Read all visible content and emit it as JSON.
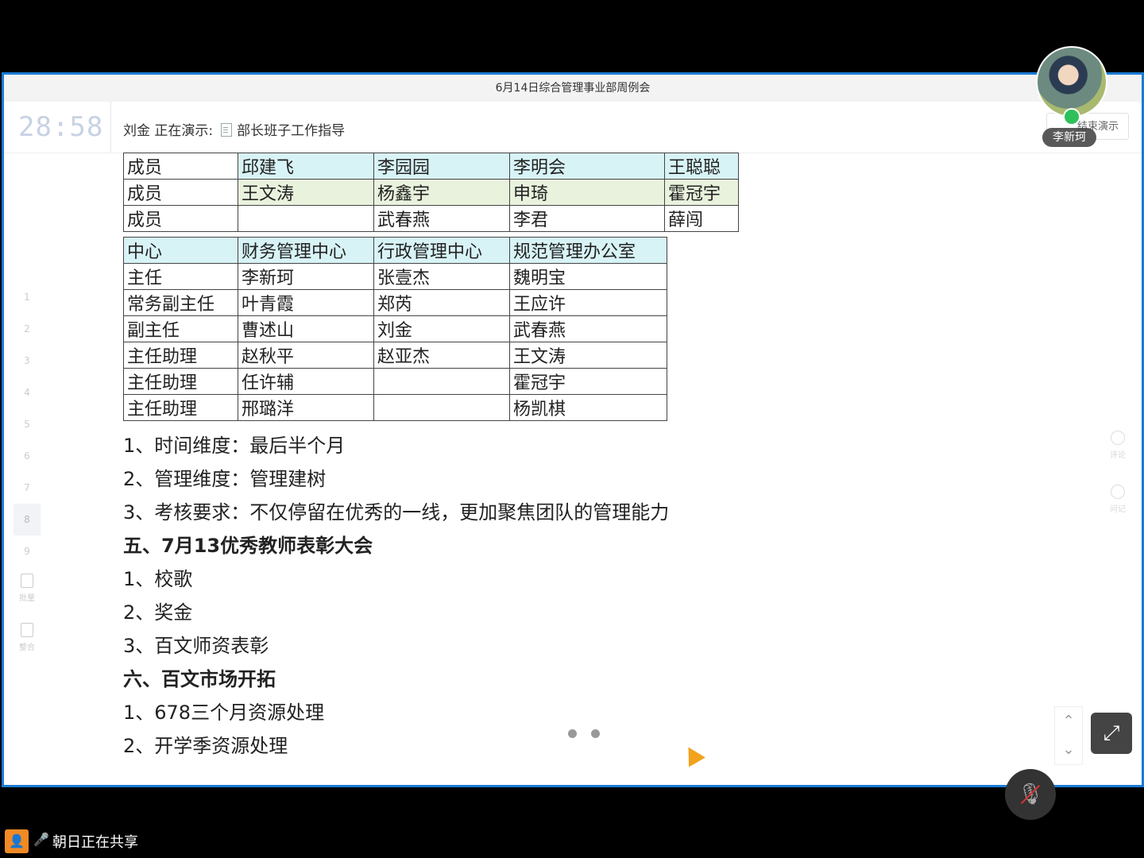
{
  "meeting": {
    "title": "6月14日综合管理事业部周例会"
  },
  "status": {
    "timer": "28:58",
    "presenter_label": "刘金 正在演示:",
    "doc_name": "部长班子工作指导",
    "end_button": "结束演示"
  },
  "sidebar": {
    "slides": [
      "1",
      "2",
      "3",
      "4",
      "5",
      "6",
      "7",
      "8",
      "9"
    ],
    "tools": [
      "批量",
      "整合"
    ]
  },
  "right_tools": [
    "评论",
    "问记"
  ],
  "table1": {
    "rows": [
      [
        "成员",
        "邱建飞",
        "李园园",
        "李明会",
        "王聪聪"
      ],
      [
        "成员",
        "王文涛",
        "杨鑫宇",
        "申琦",
        "霍冠宇"
      ],
      [
        "成员",
        "",
        "武春燕",
        "李君",
        "薛闯"
      ]
    ]
  },
  "table2": {
    "header": [
      "中心",
      "财务管理中心",
      "行政管理中心",
      "规范管理办公室"
    ],
    "rows": [
      [
        "主任",
        "李新珂",
        "张壹杰",
        "魏明宝"
      ],
      [
        "常务副主任",
        "叶青霞",
        "郑芮",
        "王应许"
      ],
      [
        "副主任",
        "曹述山",
        "刘金",
        "武春燕"
      ],
      [
        "主任助理",
        "赵秋平",
        "赵亚杰",
        "王文涛"
      ],
      [
        "主任助理",
        "任许辅",
        "",
        "霍冠宇"
      ],
      [
        "主任助理",
        "邢璐洋",
        "",
        "杨凯棋"
      ]
    ]
  },
  "outline": [
    {
      "text": "1、时间维度：最后半个月",
      "bold": false
    },
    {
      "text": "2、管理维度：管理建树",
      "bold": false
    },
    {
      "text": "3、考核要求：不仅停留在优秀的一线，更加聚焦团队的管理能力",
      "bold": false
    },
    {
      "text": "五、7月13优秀教师表彰大会",
      "bold": true
    },
    {
      "text": "1、校歌",
      "bold": false
    },
    {
      "text": "2、奖金",
      "bold": false
    },
    {
      "text": "3、百文师资表彰",
      "bold": false
    },
    {
      "text": "六、百文市场开拓",
      "bold": true
    },
    {
      "text": "1、678三个月资源处理",
      "bold": false
    },
    {
      "text": "2、开学季资源处理",
      "bold": false
    }
  ],
  "participant": {
    "name": "李新珂"
  },
  "share": {
    "text": "朝日正在共享"
  },
  "icons": {
    "scroll_up": "⌃",
    "scroll_down": "⌄",
    "expand": "⤢",
    "mic_off": "🎙",
    "person": "👤",
    "share_mic": "🎤"
  },
  "colors": {
    "frame_border": "#1a7bd6",
    "row_cyan": "#d8f3f6",
    "row_green": "#e9f2dd",
    "share_accent": "#f08a24"
  }
}
